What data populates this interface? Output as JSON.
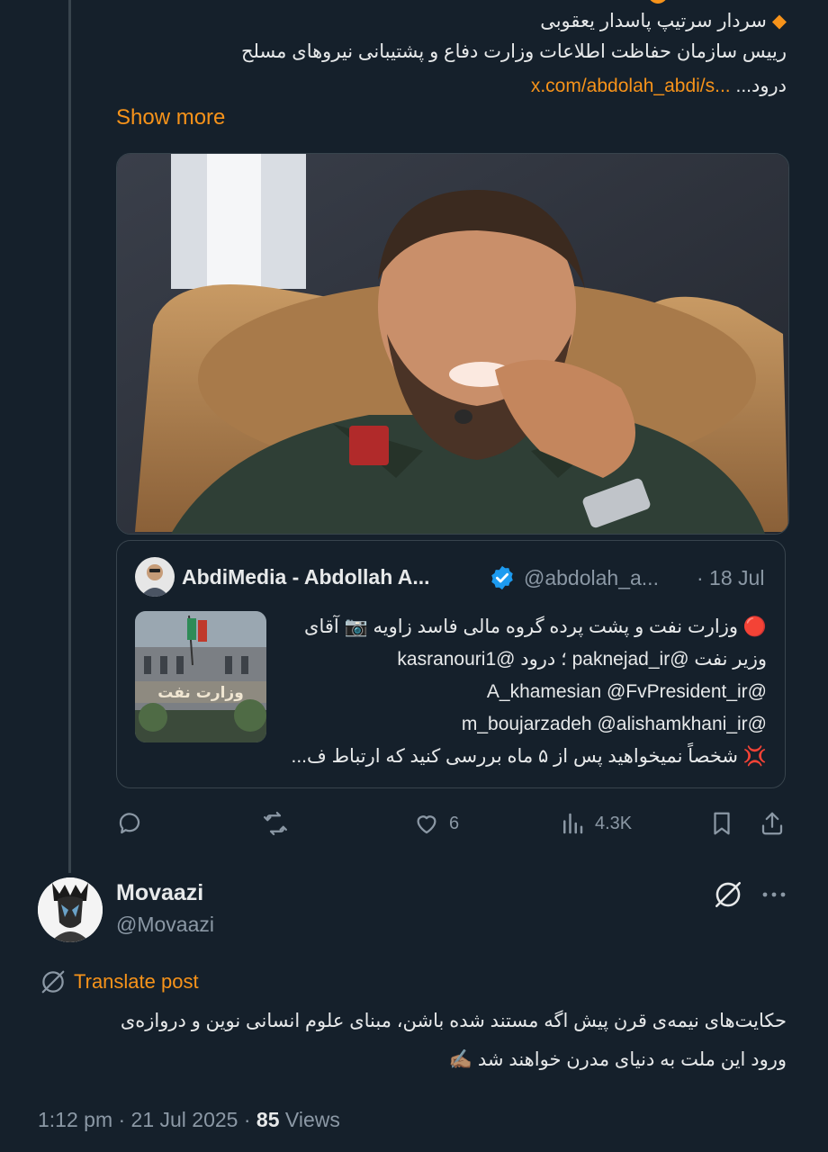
{
  "tweet": {
    "line1": "سردار سرتیپ پاسدار یعقوبی",
    "line2": "رییس سازمان حفاظت اطلاعات وزارت دفاع و پشتیبانی نیروهای مسلح",
    "line3_prefix": "درود...",
    "line3_link": "x.com/abdolah_abdi/s...",
    "show_more": "Show more"
  },
  "quote": {
    "name": "AbdiMedia - Abdollah A...",
    "handle": "@abdolah_a...",
    "date": "· 18 Jul",
    "thumb_sign": "وزارت نفت",
    "lines": [
      "🔴 وزارت نفت و پشت پرده گروه مالی فاسد زاویه 📷 آقای",
      "وزیر نفت @paknejad_ir ؛ درود @kasranouri1",
      "@A_khamesian @FvPresident_ir",
      "@m_boujarzadeh @alishamkhani_ir",
      "💢 شخصاً نمیخواهید پس از ۵ ماه بررسی کنید که ارتباط ف..."
    ]
  },
  "actions": {
    "likes": "6",
    "views": "4.3K"
  },
  "reply": {
    "name": "Movaazi",
    "handle": "@Movaazi",
    "translate": "Translate post",
    "line1": "حکایت‌های نیمه‌ی قرن پیش اگه مستند شده باشن، مبنای علوم انسانی نوین و دروازه‌ی",
    "line2": "ورود این ملت به دنیای مدرن خواهند شد ✍🏽",
    "time": "1:12 pm · 21 Jul 2025 · ",
    "views_count": "85",
    "views_label": " Views"
  },
  "colors": {
    "background": "#15202b",
    "accent": "#f7931a",
    "muted": "#8b98a5",
    "verified": "#1d9bf0"
  }
}
